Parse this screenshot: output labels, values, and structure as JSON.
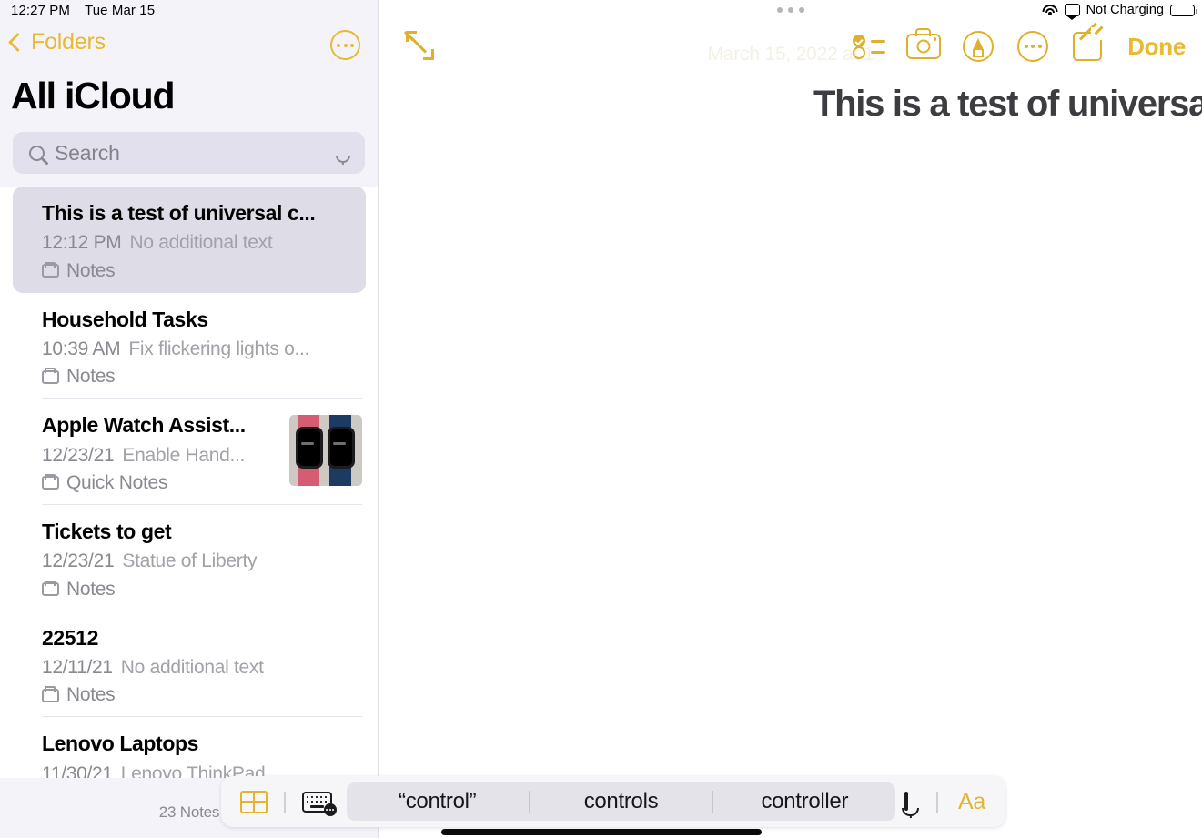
{
  "status_bar": {
    "time": "12:27 PM",
    "date": "Tue Mar 15",
    "wifi_icon": "wifi-icon",
    "airplay_icon": "airplay-screen-icon",
    "charging_text": "Not Charging",
    "battery_icon": "battery-icon"
  },
  "sidebar": {
    "back_label": "Folders",
    "back_icon": "chevron-left-icon",
    "more_icon": "more-circle-icon",
    "title": "All iCloud",
    "search": {
      "placeholder": "Search",
      "icon": "search-icon",
      "mic_icon": "microphone-icon"
    },
    "notes_count": "23 Notes",
    "notes": [
      {
        "title": "This is a test of universal c...",
        "date": "12:12 PM",
        "snippet": "No additional text",
        "folder": "Notes",
        "selected": true,
        "thumbnail": false
      },
      {
        "title": "Household Tasks",
        "date": "10:39 AM",
        "snippet": "Fix flickering lights o...",
        "folder": "Notes",
        "selected": false,
        "thumbnail": false
      },
      {
        "title": "Apple Watch Assist...",
        "date": "12/23/21",
        "snippet": "Enable Hand...",
        "folder": "Quick Notes",
        "selected": false,
        "thumbnail": true
      },
      {
        "title": "Tickets to get",
        "date": "12/23/21",
        "snippet": "Statue of Liberty",
        "folder": "Notes",
        "selected": false,
        "thumbnail": false
      },
      {
        "title": "22512",
        "date": "12/11/21",
        "snippet": "No additional text",
        "folder": "Notes",
        "selected": false,
        "thumbnail": false
      },
      {
        "title": "Lenovo Laptops",
        "date": "11/30/21",
        "snippet": "Lenovo ThinkPad",
        "folder": "",
        "selected": false,
        "thumbnail": false
      }
    ]
  },
  "editor": {
    "multitask_icon": "multitasking-handle-icon",
    "expand_icon": "expand-arrows-icon",
    "date_line": "March 15, 2022 at 1",
    "note_title": "This is a test of universal control",
    "pointer_dot": "pointer-dot",
    "toolbar": {
      "checklist_icon": "checklist-icon",
      "camera_icon": "camera-icon",
      "markup_icon": "markup-pen-icon",
      "more_icon": "more-circle-icon",
      "compose_icon": "compose-icon",
      "done_label": "Done"
    }
  },
  "predictive_bar": {
    "table_icon": "table-icon",
    "keyboard_icon": "keyboard-options-icon",
    "suggestions": [
      "“control”",
      "controls",
      "controller"
    ],
    "mic_icon": "microphone-icon",
    "format_label": "Aa"
  },
  "colors": {
    "accent_yellow": "#e0b02c",
    "sidebar_bg": "#f4f3fa",
    "selected_row": "#dedce6",
    "search_bg": "#e2e0ec"
  }
}
